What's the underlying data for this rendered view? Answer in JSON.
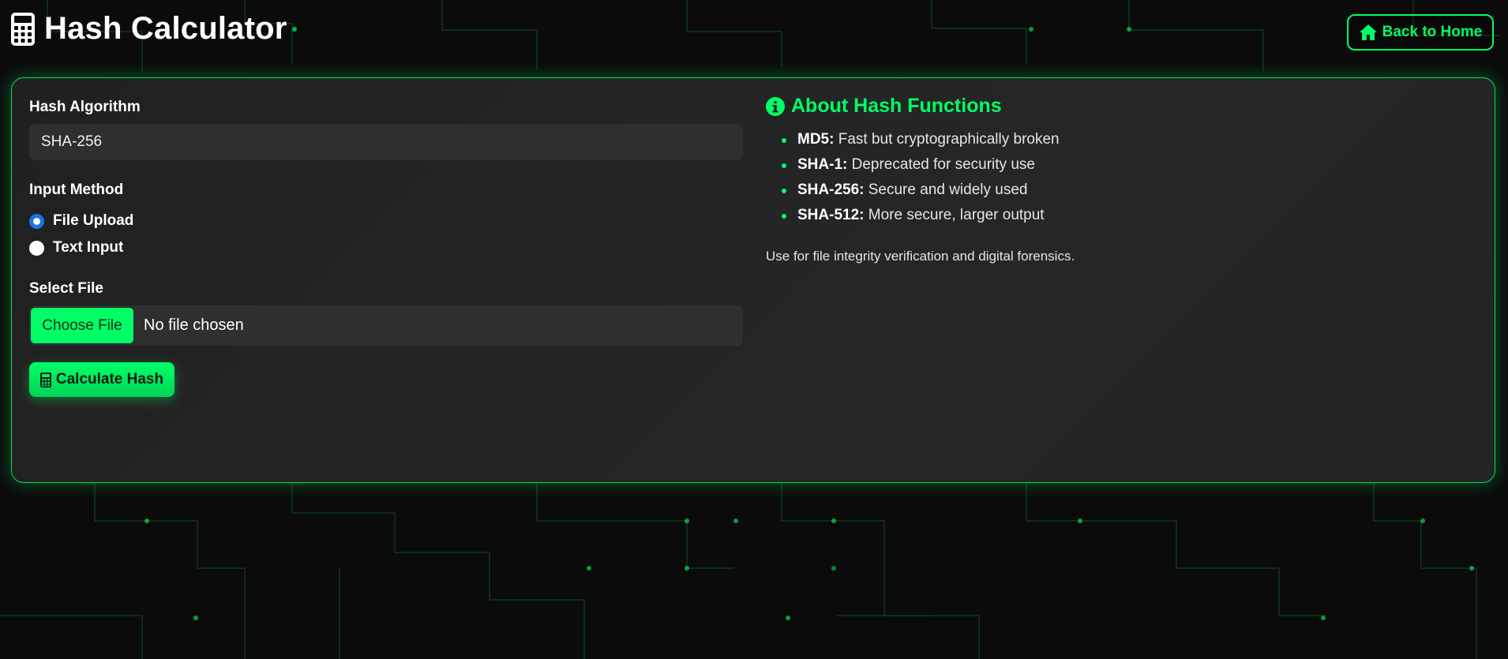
{
  "app": {
    "title": "Hash Calculator",
    "accent_color": "#00ff66",
    "back_button": {
      "label": "Back to Home",
      "icon": "home-icon"
    }
  },
  "form": {
    "algorithm_label": "Hash Algorithm",
    "algorithm_value": "SHA-256",
    "input_method_label": "Input Method",
    "input_methods": [
      {
        "label": "File Upload",
        "checked": true
      },
      {
        "label": "Text Input",
        "checked": false
      }
    ],
    "select_file_label": "Select File",
    "choose_file_label": "Choose File",
    "file_status": "No file chosen",
    "calculate_label": "Calculate Hash",
    "calculate_icon": "calculator-icon"
  },
  "about": {
    "title": "About Hash Functions",
    "icon": "info-icon",
    "items": [
      {
        "name": "MD5:",
        "desc": "Fast but cryptographically broken"
      },
      {
        "name": "SHA-1:",
        "desc": "Deprecated for security use"
      },
      {
        "name": "SHA-256:",
        "desc": "Secure and widely used"
      },
      {
        "name": "SHA-512:",
        "desc": "More secure, larger output"
      }
    ],
    "note": "Use for file integrity verification and digital forensics."
  }
}
